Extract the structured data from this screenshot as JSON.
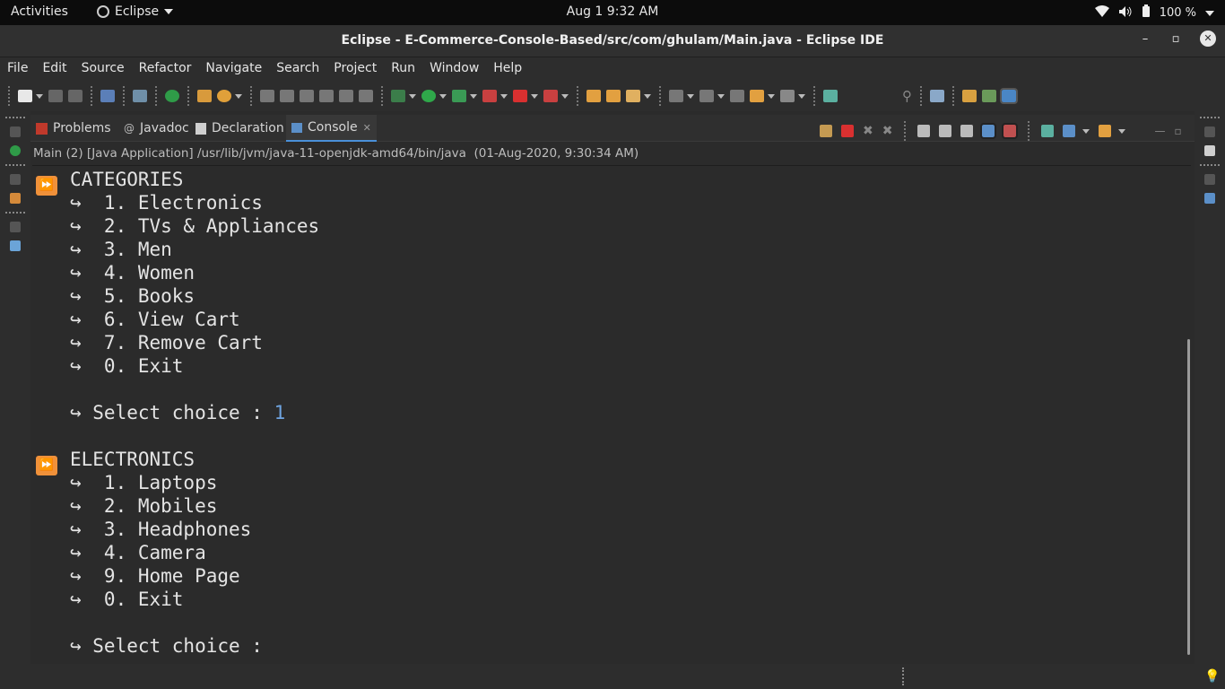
{
  "system_bar": {
    "activities": "Activities",
    "app_name": "Eclipse",
    "datetime": "Aug 1   9:32 AM",
    "battery": "100 %"
  },
  "window": {
    "title": "Eclipse - E-Commerce-Console-Based/src/com/ghulam/Main.java - Eclipse IDE",
    "controls": {
      "minimize": "–",
      "maximize": "▫",
      "close": "✕"
    }
  },
  "menubar": [
    "File",
    "Edit",
    "Source",
    "Refactor",
    "Navigate",
    "Search",
    "Project",
    "Run",
    "Window",
    "Help"
  ],
  "views": {
    "tabs": [
      {
        "label": "Problems",
        "icon": "problems-icon"
      },
      {
        "label": "Javadoc",
        "icon": "javadoc-icon"
      },
      {
        "label": "Declaration",
        "icon": "declaration-icon"
      },
      {
        "label": "Console",
        "icon": "console-icon",
        "active": true
      }
    ]
  },
  "console": {
    "process_line": "Main (2) [Java Application] /usr/lib/jvm/java-11-openjdk-amd64/bin/java  (01-Aug-2020, 9:30:34 AM)",
    "lines": [
      {
        "marker": true,
        "text": "CATEGORIES"
      },
      {
        "text": "↪  1. Electronics"
      },
      {
        "text": "↪  2. TVs & Appliances"
      },
      {
        "text": "↪  3. Men"
      },
      {
        "text": "↪  4. Women"
      },
      {
        "text": "↪  5. Books"
      },
      {
        "text": "↪  6. View Cart"
      },
      {
        "text": "↪  7. Remove Cart"
      },
      {
        "text": "↪  0. Exit"
      },
      {
        "text": ""
      },
      {
        "text": "↪ Select choice : ",
        "input": "1"
      },
      {
        "text": ""
      },
      {
        "marker": true,
        "text": "ELECTRONICS"
      },
      {
        "text": "↪  1. Laptops"
      },
      {
        "text": "↪  2. Mobiles"
      },
      {
        "text": "↪  3. Headphones"
      },
      {
        "text": "↪  4. Camera"
      },
      {
        "text": "↪  9. Home Page"
      },
      {
        "text": "↪  0. Exit"
      },
      {
        "text": ""
      },
      {
        "text": "↪ Select choice : ",
        "input": ""
      }
    ]
  },
  "colors": {
    "accent": "#4a90d9",
    "marker": "#f0913a",
    "input": "#6fa4e0"
  }
}
